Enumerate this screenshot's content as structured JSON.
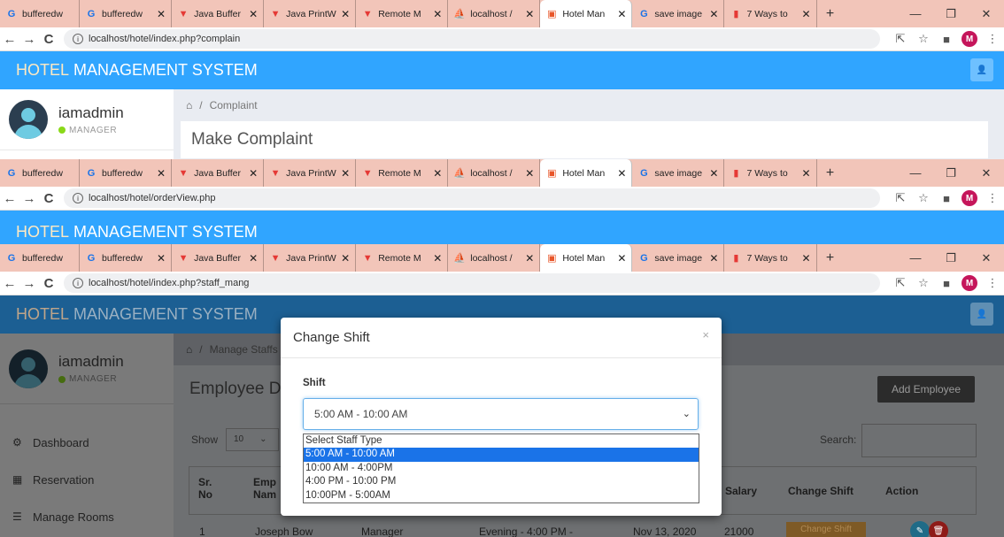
{
  "browser": {
    "tabs": [
      {
        "label": "bufferedw",
        "icon": "google-icon",
        "icon_char": "G",
        "icon_color": "#1a73e8",
        "active": false
      },
      {
        "label": "bufferedw",
        "icon": "google-icon",
        "icon_char": "G",
        "icon_color": "#1a73e8",
        "active": false
      },
      {
        "label": "Java Buffer",
        "icon": "vidyabhoomi-icon",
        "icon_char": "▼",
        "icon_color": "#e53935",
        "active": false
      },
      {
        "label": "Java PrintW",
        "icon": "vidyabhoomi-icon",
        "icon_char": "▼",
        "icon_color": "#e53935",
        "active": false
      },
      {
        "label": "Remote M",
        "icon": "vidyabhoomi-icon",
        "icon_char": "▼",
        "icon_color": "#e53935",
        "active": false
      },
      {
        "label": "localhost /",
        "icon": "phpmyadmin-icon",
        "icon_char": "⛵",
        "icon_color": "#f29111",
        "active": false
      },
      {
        "label": "Hotel Man",
        "icon": "hotel-icon",
        "icon_char": "▣",
        "icon_color": "#e8562a",
        "active": true
      },
      {
        "label": "save image",
        "icon": "google-icon",
        "icon_char": "G",
        "icon_color": "#1a73e8",
        "active": false
      },
      {
        "label": "7 Ways to",
        "icon": "site-icon",
        "icon_char": "▮",
        "icon_color": "#e53935",
        "active": false
      }
    ],
    "new_tab": "+",
    "win_min": "—",
    "win_restore": "❐",
    "win_close": "✕",
    "tab_close": "✕",
    "back": "←",
    "forward": "→",
    "reload": "C",
    "info": "i",
    "share": "⇱",
    "star": "☆",
    "sidepanel": "■",
    "profile_initial": "M",
    "menu": "⋮",
    "windows": [
      {
        "url": "localhost/hotel/index.php?complain"
      },
      {
        "url": "localhost/hotel/orderView.php"
      },
      {
        "url": "localhost/hotel/index.php?staff_mang"
      }
    ]
  },
  "app": {
    "brand_part1": "HOTEL",
    "brand_part2": " MANAGEMENT SYSTEM",
    "user_icon": "👤",
    "username": "iamadmin",
    "role": "MANAGER",
    "home_icon": "⌂",
    "win1": {
      "breadcrumb": "Complaint",
      "panel_title": "Make Complaint"
    },
    "win3": {
      "breadcrumb": "Manage Staffs",
      "page_title": "Employee D",
      "add_button": "Add Employee",
      "show_label": "Show",
      "show_value": "10",
      "search_label": "Search:",
      "menu": [
        {
          "label": "Dashboard",
          "icon": "⚙"
        },
        {
          "label": "Reservation",
          "icon": "▦"
        },
        {
          "label": "Manage Rooms",
          "icon": "☰"
        }
      ],
      "table": {
        "headers": [
          "Sr. No",
          "Emp Nam",
          "Salary",
          "Change Shift",
          "Action"
        ],
        "row": {
          "sr": "1",
          "name": "Joseph Bow",
          "type": "Manager",
          "shift": "Evening - 4:00 PM -",
          "date": "Nov 13, 2020",
          "salary": "21000",
          "change_button": "Change Shift"
        }
      }
    }
  },
  "modal": {
    "title": "Change Shift",
    "close": "×",
    "field_label": "Shift",
    "selected_value": "5:00 AM - 10:00 AM",
    "chevron": "⌄",
    "options": [
      "Select Staff Type",
      "5:00 AM - 10:00 AM",
      "10:00 AM - 4:00PM",
      "4:00 PM - 10:00 PM",
      "10:00PM - 5:00AM"
    ],
    "highlighted_option": 1
  }
}
